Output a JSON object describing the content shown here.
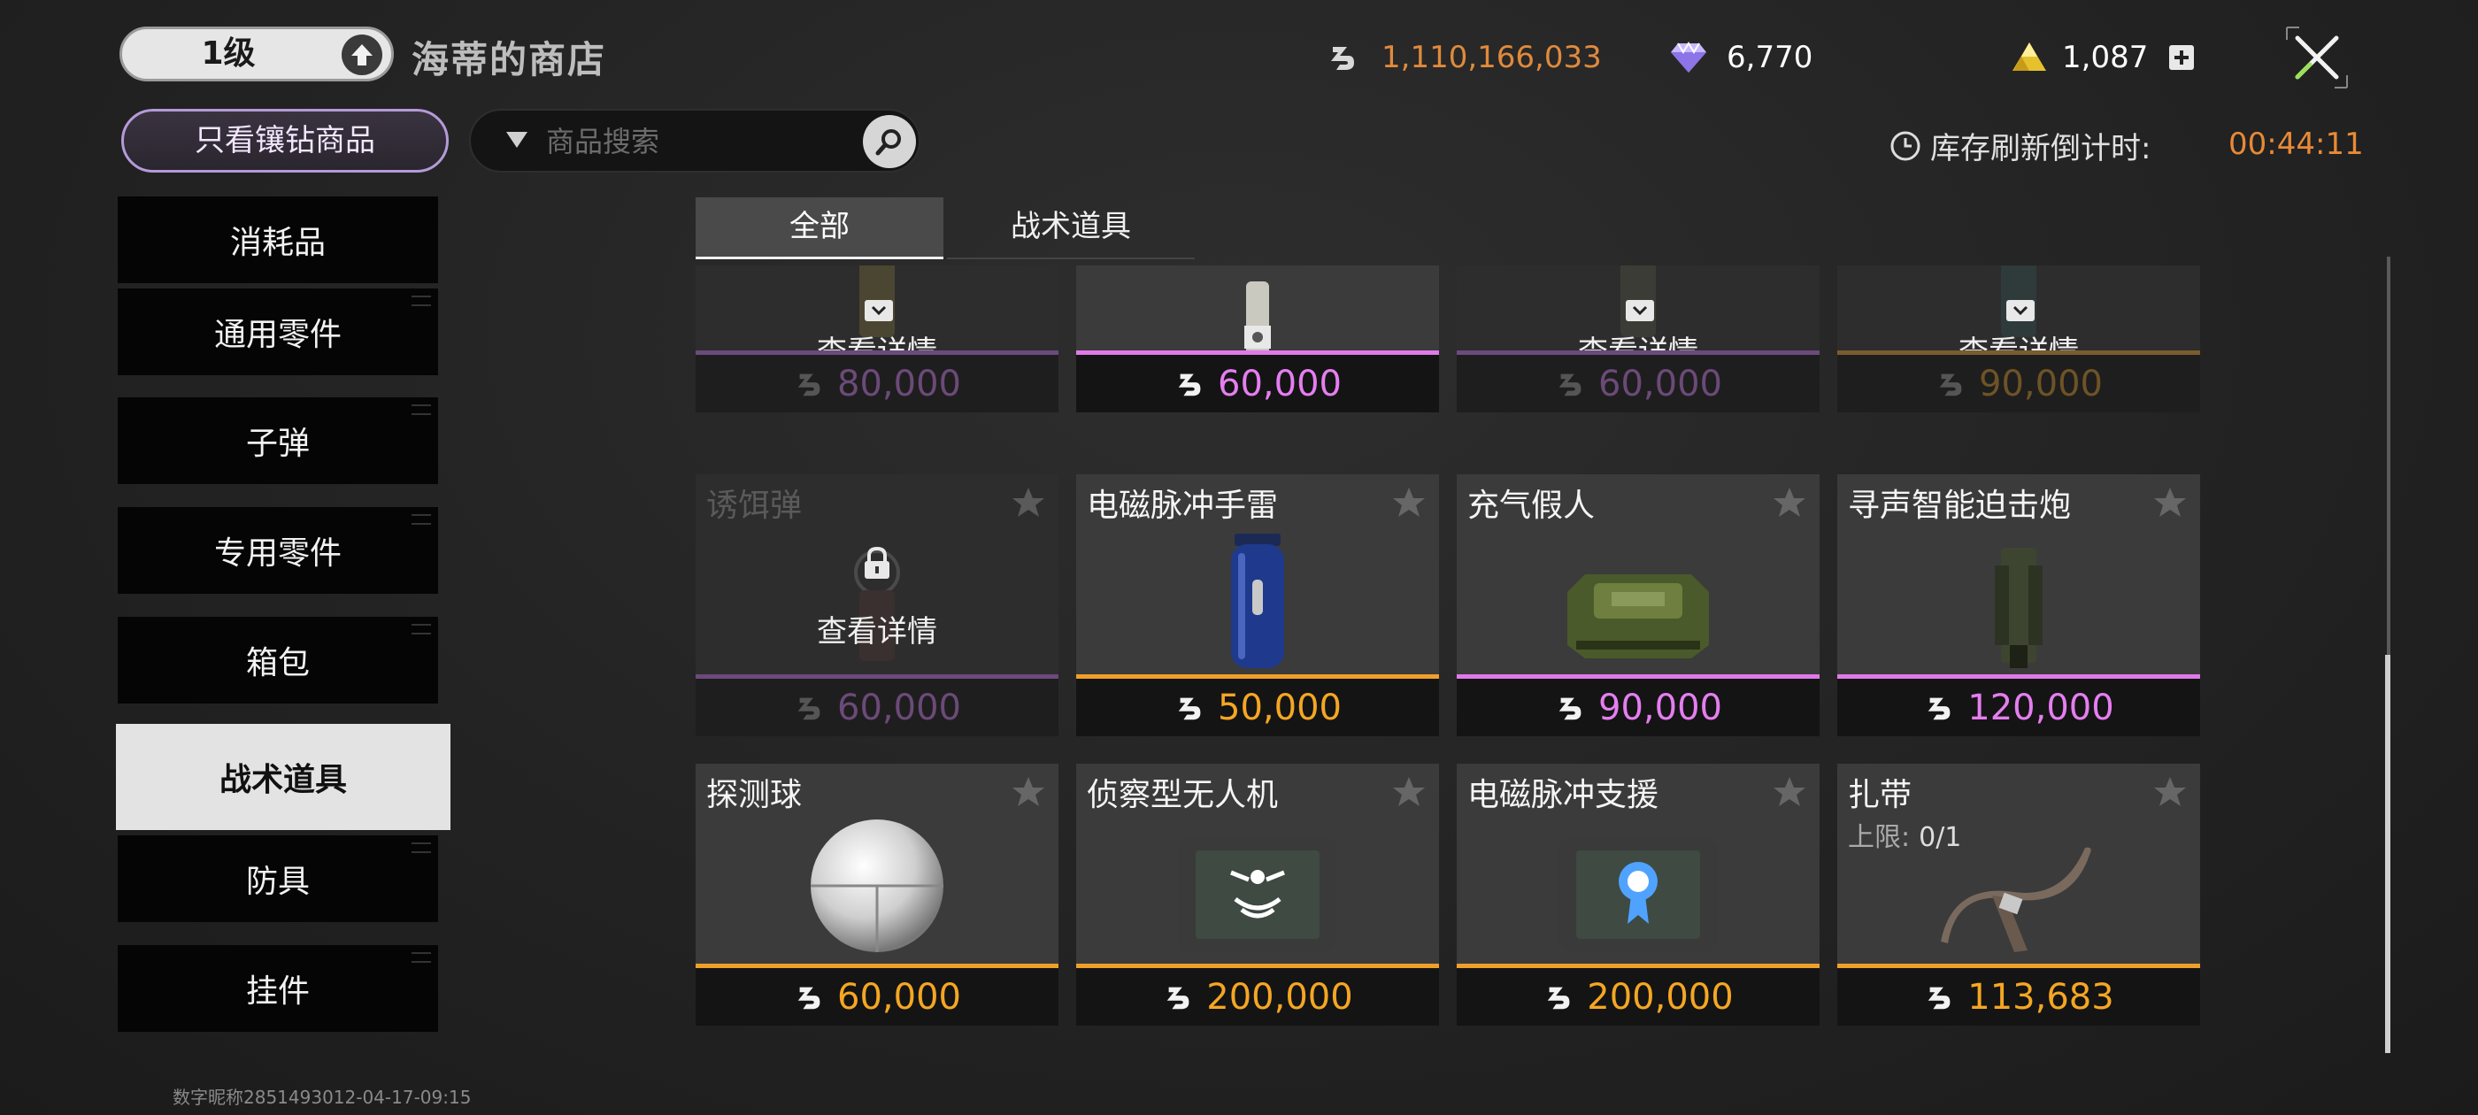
{
  "header": {
    "level": "1级",
    "shop_title": "海蒂的商店",
    "currencies": [
      {
        "icon": "hafu-coin-icon",
        "value": "1,110,166,033",
        "color": "#e08a3c"
      },
      {
        "icon": "diamond-icon",
        "value": "6,770",
        "color": "#ffffff"
      },
      {
        "icon": "triangle-coin-icon",
        "value": "1,087",
        "color": "#ffffff"
      }
    ],
    "refresh_label": "库存刷新倒计时:",
    "refresh_time": "00:44:11"
  },
  "filter": {
    "only_diamond_label": "只看镶钻商品",
    "search_placeholder": "商品搜索"
  },
  "sidebar": {
    "items": [
      {
        "label": "消耗品",
        "active": false
      },
      {
        "label": "通用零件",
        "active": false
      },
      {
        "label": "子弹",
        "active": false
      },
      {
        "label": "专用零件",
        "active": false
      },
      {
        "label": "箱包",
        "active": false
      },
      {
        "label": "战术道具",
        "active": true
      },
      {
        "label": "防具",
        "active": false
      },
      {
        "label": "挂件",
        "active": false
      }
    ]
  },
  "tabs": [
    {
      "label": "全部",
      "active": true
    },
    {
      "label": "战术道具",
      "active": false
    }
  ],
  "items": [
    {
      "name": "",
      "price": "80,000",
      "locked": true,
      "detail": "查看详情",
      "rarity_color": "#7a4f8e",
      "price_color": "#6b4a78"
    },
    {
      "name": "",
      "price": "60,000",
      "locked": false,
      "detail": "",
      "rarity_color": "#e07ae8",
      "price_color": "#e57ef0"
    },
    {
      "name": "",
      "price": "60,000",
      "locked": true,
      "detail": "查看详情",
      "rarity_color": "#7a4f8e",
      "price_color": "#6b4a78"
    },
    {
      "name": "",
      "price": "90,000",
      "locked": true,
      "detail": "查看详情",
      "rarity_color": "#7a5c2e",
      "price_color": "#6e5326"
    },
    {
      "name": "诱饵弹",
      "price": "60,000",
      "locked": true,
      "detail": "查看详情",
      "rarity_color": "#6b4a7d",
      "price_color": "#6b4a78"
    },
    {
      "name": "电磁脉冲手雷",
      "price": "50,000",
      "locked": false,
      "detail": "",
      "rarity_color": "#f0a02a",
      "price_color": "#f5a623"
    },
    {
      "name": "充气假人",
      "price": "90,000",
      "locked": false,
      "detail": "",
      "rarity_color": "#e07ae8",
      "price_color": "#e57ef0"
    },
    {
      "name": "寻声智能迫击炮",
      "price": "120,000",
      "locked": false,
      "detail": "",
      "rarity_color": "#e07ae8",
      "price_color": "#e57ef0"
    },
    {
      "name": "探测球",
      "price": "60,000",
      "locked": false,
      "detail": "",
      "rarity_color": "#f0a02a",
      "price_color": "#f5a623"
    },
    {
      "name": "侦察型无人机",
      "price": "200,000",
      "locked": false,
      "detail": "",
      "rarity_color": "#f0a02a",
      "price_color": "#f5a623"
    },
    {
      "name": "电磁脉冲支援",
      "price": "200,000",
      "locked": false,
      "detail": "",
      "rarity_color": "#f0a02a",
      "price_color": "#f5a623"
    },
    {
      "name": "扎带",
      "price": "113,683",
      "locked": false,
      "detail": "",
      "limit_label": "上限:",
      "limit_value": "0/1",
      "rarity_color": "#f0a02a",
      "price_color": "#f5a623"
    }
  ],
  "footer": {
    "watermark": "数字昵称2851493012-04-17-09:15"
  }
}
